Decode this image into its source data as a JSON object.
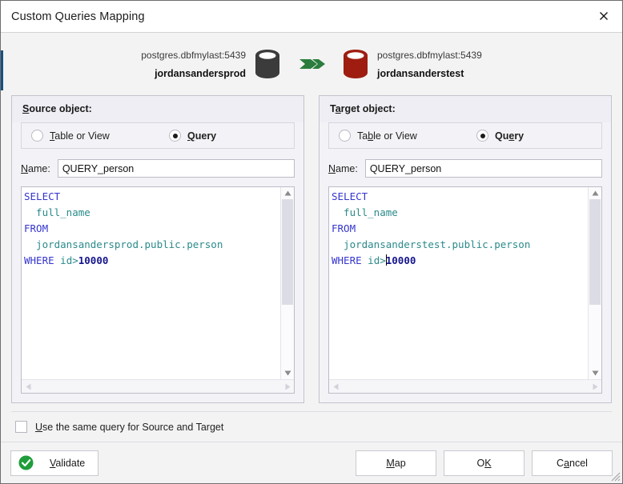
{
  "window": {
    "title": "Custom Queries Mapping",
    "close_icon": "close-icon"
  },
  "connections": {
    "source": {
      "host": "postgres.dbfmylast:5439",
      "name": "jordansandersprod",
      "icon": "database-cylinder-icon",
      "color": "#3b3b3b"
    },
    "arrow": {
      "icon": "arrow-right-icon",
      "color": "#2a7d3c"
    },
    "target": {
      "host": "postgres.dbfmylast:5439",
      "name": "jordansanderstest",
      "icon": "database-cylinder-icon",
      "color": "#9e1d10"
    }
  },
  "source_panel": {
    "title_pre": "S",
    "title_post": "ource object:",
    "radio_table": {
      "pre": "T",
      "post": "able or View",
      "selected": false
    },
    "radio_query": {
      "pre": "Q",
      "post": "uery",
      "selected": true
    },
    "name_label_pre": "N",
    "name_label_post": "ame:",
    "name_value": "QUERY_person",
    "sql": {
      "line1_kw": "SELECT",
      "line2_idn": "  full_name",
      "line3_kw": "FROM",
      "line4_idn": "  jordansandersprod.public.person",
      "line5_kw": "WHERE",
      "line5_idn": " id",
      "line5_op": ">",
      "line5_num": "10000"
    },
    "has_caret": false
  },
  "target_panel": {
    "title_pre": "T",
    "title_mn": "a",
    "title_post": "rget object:",
    "radio_table": {
      "pre": "Ta",
      "mn": "b",
      "post": "le or View",
      "selected": false
    },
    "radio_query": {
      "pre": "Qu",
      "mn": "e",
      "post": "ry",
      "selected": true
    },
    "name_label_pre": "N",
    "name_label_post": "ame:",
    "name_value": "QUERY_person",
    "sql": {
      "line1_kw": "SELECT",
      "line2_idn": "  full_name",
      "line3_kw": "FROM",
      "line4_idn": "  jordansanderstest.public.person",
      "line5_kw": "WHERE",
      "line5_idn": " id",
      "line5_op": ">",
      "line5_num": "10000"
    },
    "has_caret": true
  },
  "same_query_checkbox": {
    "checked": false,
    "label_pre": "U",
    "label_post": "se the same query for Source and Target"
  },
  "footer": {
    "validate": {
      "pre": "V",
      "post": "alidate",
      "icon": "check-circle-icon",
      "color": "#1f9d3a"
    },
    "map": {
      "pre": "M",
      "post": "ap"
    },
    "ok": {
      "pre": "O",
      "mn": "K",
      "post": ""
    },
    "cancel": {
      "pre": "C",
      "mn": "a",
      "post": "ncel"
    },
    "grip_icon": "resize-grip-icon"
  }
}
